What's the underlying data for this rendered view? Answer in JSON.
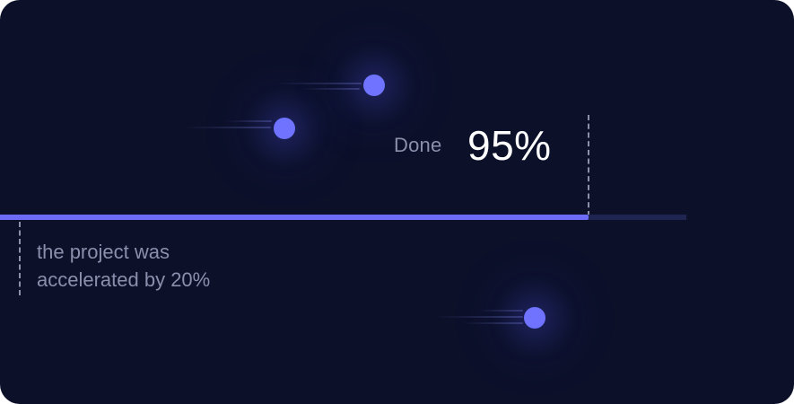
{
  "progress": {
    "status_label": "Done",
    "value_text": "95%",
    "fraction": 0.95
  },
  "note": {
    "line1": "the project was",
    "line2": "accelerated by 20%"
  },
  "colors": {
    "background": "#0c1029",
    "accent": "#6c6cf7",
    "track": "#1f2551",
    "muted_text": "#8b8fab",
    "value_text": "#ffffff"
  }
}
